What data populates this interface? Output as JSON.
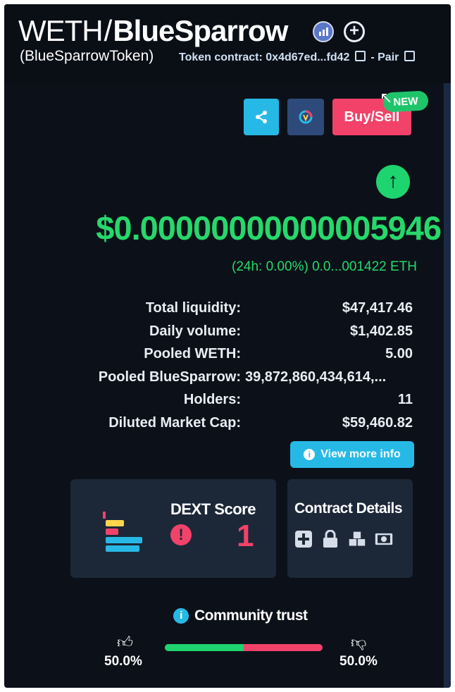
{
  "header": {
    "base_token": "WETH",
    "separator": "/",
    "quote_token": "BlueSparrow",
    "token_full_name": "(BlueSparrowToken)",
    "contract_label": "Token contract: 0x4d67ed...fd42",
    "pair_label": "- Pair"
  },
  "actions": {
    "buy_sell_label": "Buy/Sell",
    "new_badge": "NEW",
    "share_icon": "share-icon",
    "dextools_icon": "dextools-logo-icon"
  },
  "price": {
    "direction": "up",
    "usd": "$0.00000000000005946",
    "change_line": "(24h: 0.00%) 0.0...001422 ETH"
  },
  "stats": [
    {
      "label": "Total liquidity:",
      "value": "$47,417.46"
    },
    {
      "label": "Daily volume:",
      "value": "$1,402.85"
    },
    {
      "label": "Pooled WETH:",
      "value": "5.00"
    },
    {
      "label": "Pooled BlueSparrow:",
      "value": "39,872,860,434,614,..."
    },
    {
      "label": "Holders:",
      "value": "11"
    },
    {
      "label": "Diluted Market Cap:",
      "value": "$59,460.82"
    }
  ],
  "view_more_label": "View more info",
  "dext": {
    "title": "DEXT Score",
    "score": "1"
  },
  "contract_details": {
    "title": "Contract Details",
    "icons": [
      "plus-square-icon",
      "lock-icon",
      "blocks-icon",
      "money-icon"
    ]
  },
  "community": {
    "title": "Community trust",
    "up_percent": "50.0%",
    "down_percent": "50.0%",
    "up_fraction": 0.5
  },
  "colors": {
    "accent_green": "#26d86b",
    "accent_red": "#f2426a",
    "accent_blue": "#27b9e6",
    "background": "#0c1119"
  }
}
